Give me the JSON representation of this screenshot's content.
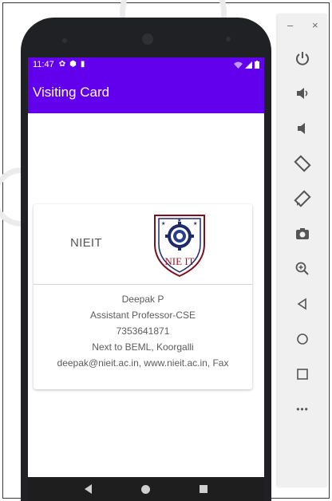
{
  "status_bar": {
    "time": "11:47"
  },
  "app_bar": {
    "title": "Visiting Card"
  },
  "card": {
    "organization": "NIEIT",
    "logo_text": "NIE IT",
    "name": "Deepak P",
    "designation": "Assistant Professor-CSE",
    "phone": "7353641871",
    "address": "Next to BEML, Koorgalli",
    "contact": "deepak@nieit.ac.in, www.nieit.ac.in, Fax"
  },
  "emulator_toolbar": {
    "window_controls": {
      "minimize": "–",
      "close": "×"
    },
    "tools": [
      "power-icon",
      "volume-up-icon",
      "volume-down-icon",
      "rotate-left-icon",
      "rotate-right-icon",
      "camera-icon",
      "zoom-icon",
      "back-icon",
      "home-icon",
      "overview-icon",
      "more-icon"
    ],
    "more_label": "•••"
  },
  "colors": {
    "accent": "#6200ee",
    "device": "#202124",
    "toolbar": "#f0f0f0"
  }
}
